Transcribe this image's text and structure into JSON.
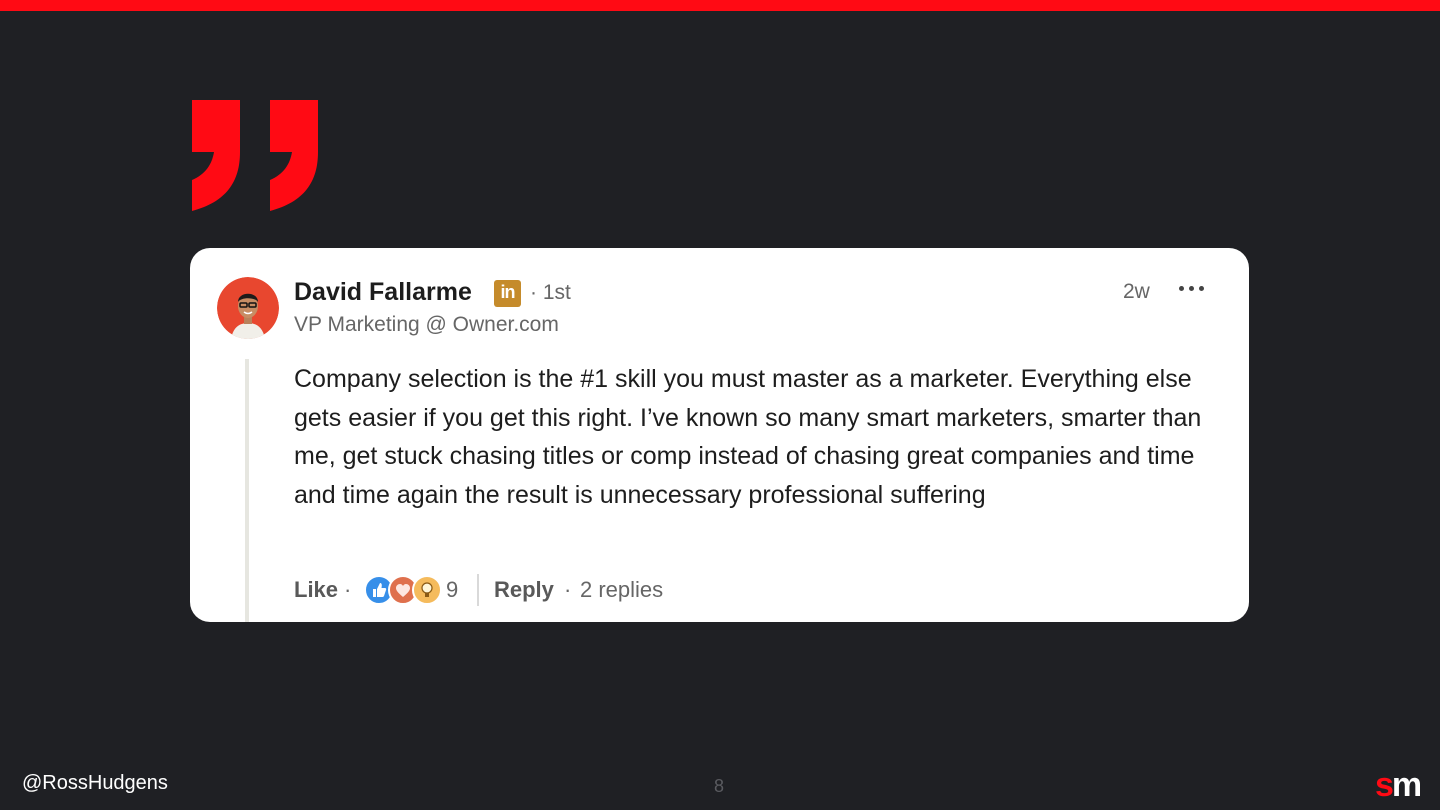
{
  "slide": {
    "accent_color": "#ff0a14",
    "background_color": "#1f2024",
    "quote_icon": "closing-quote-icon"
  },
  "comment": {
    "author": "David Fallarme",
    "badge": "in",
    "degree": "· 1st",
    "headline": "VP Marketing @ Owner.com",
    "timestamp": "2w",
    "more_icon": "more-options-icon",
    "text": "Company selection is the #1 skill you must master as a marketer. Everything else gets easier if you get this right. I’ve known so many smart marketers, smarter than me, get stuck chasing titles or comp instead of chasing great companies and time and time again the result is unnecessary professional suffering",
    "actions": {
      "like": "Like",
      "separator": "·",
      "reactions": [
        "like-reaction-icon",
        "love-reaction-icon",
        "insightful-reaction-icon"
      ],
      "reaction_count": "9",
      "reply": "Reply",
      "replies": "2 replies"
    }
  },
  "footer": {
    "handle": "@RossHudgens",
    "page_number": "8",
    "logo_s": "s",
    "logo_m": "m"
  }
}
